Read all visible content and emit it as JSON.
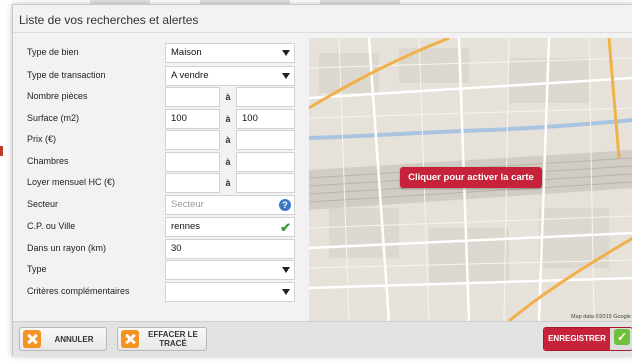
{
  "dialog": {
    "title": "Liste de vos recherches et alertes"
  },
  "form": {
    "type_bien": {
      "label": "Type de bien",
      "value": "Maison"
    },
    "type_transaction": {
      "label": "Type de transaction",
      "value": "A vendre"
    },
    "nombre_pieces": {
      "label": "Nombre pièces",
      "from": "",
      "sep": "à",
      "to": ""
    },
    "surface": {
      "label": "Surface (m2)",
      "from": "100",
      "sep": "à",
      "to": "100"
    },
    "prix": {
      "label": "Prix (€)",
      "from": "",
      "sep": "à",
      "to": ""
    },
    "chambres": {
      "label": "Chambres",
      "from": "",
      "sep": "à",
      "to": ""
    },
    "loyer": {
      "label": "Loyer mensuel HC (€)",
      "from": "",
      "sep": "à",
      "to": ""
    },
    "secteur": {
      "label": "Secteur",
      "placeholder": "Secteur",
      "help": "?"
    },
    "cp_ville": {
      "label": "C.P. ou Ville",
      "value": "rennes",
      "check": "✔"
    },
    "rayon": {
      "label": "Dans un rayon (km)",
      "value": "30"
    },
    "type": {
      "label": "Type",
      "value": ""
    },
    "criteres": {
      "label": "Critères complémentaires",
      "value": ""
    }
  },
  "map": {
    "activate_label": "Cliquer pour activer la carte",
    "credit": "Map data ©2015 Google"
  },
  "footer": {
    "cancel_label": "ANNULER",
    "clear_label": "EFFACER LE TRACÉ",
    "save_label": "ENREGISTRER"
  },
  "colors": {
    "accent": "#c6233a",
    "icon_orange": "#f29322",
    "check_green": "#3b9b3b",
    "help_blue": "#3b78c4"
  },
  "icons": {
    "cancel": "close-icon",
    "clear": "close-icon",
    "save": "check-icon",
    "help": "help-icon",
    "select": "chevron-down-icon"
  }
}
